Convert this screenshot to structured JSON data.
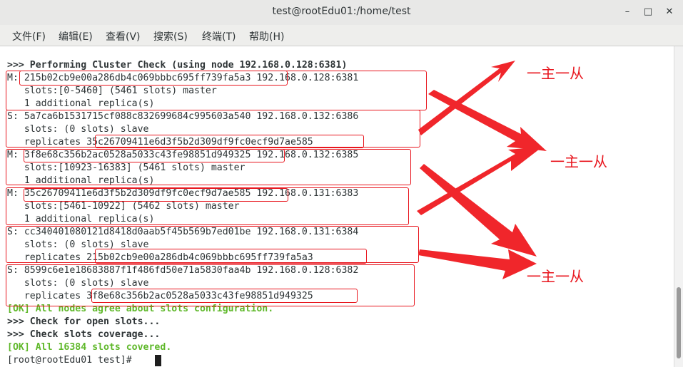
{
  "window": {
    "title": "test@rootEdu01:/home/test"
  },
  "menu": [
    "文件(F)",
    "编辑(E)",
    "查看(V)",
    "搜索(S)",
    "终端(T)",
    "帮助(H)"
  ],
  "terminal_lines": [
    {
      "prefix": ">>> ",
      "text": "Performing Cluster Check (using node 192.168.0.128:6381)",
      "style": "bold"
    },
    {
      "prefix": "M: ",
      "text": "215b02cb9e00a286db4c069bbbc695ff739fa5a3 192.168.0.128:6381",
      "style": ""
    },
    {
      "prefix": "   ",
      "text": "slots:[0-5460] (5461 slots) master",
      "style": ""
    },
    {
      "prefix": "   ",
      "text": "1 additional replica(s)",
      "style": ""
    },
    {
      "prefix": "S: ",
      "text": "5a7ca6b1531715cf088c832699684c995603a540 192.168.0.132:6386",
      "style": ""
    },
    {
      "prefix": "   ",
      "text": "slots: (0 slots) slave",
      "style": ""
    },
    {
      "prefix": "   ",
      "text": "replicates 35c26709411e6d3f5b2d309df9fc0ecf9d7ae585",
      "style": ""
    },
    {
      "prefix": "M: ",
      "text": "3f8e68c356b2ac0528a5033c43fe98851d949325 192.168.0.132:6385",
      "style": ""
    },
    {
      "prefix": "   ",
      "text": "slots:[10923-16383] (5461 slots) master",
      "style": ""
    },
    {
      "prefix": "   ",
      "text": "1 additional replica(s)",
      "style": ""
    },
    {
      "prefix": "M: ",
      "text": "35c26709411e6d3f5b2d309df9fc0ecf9d7ae585 192.168.0.131:6383",
      "style": ""
    },
    {
      "prefix": "   ",
      "text": "slots:[5461-10922] (5462 slots) master",
      "style": ""
    },
    {
      "prefix": "   ",
      "text": "1 additional replica(s)",
      "style": ""
    },
    {
      "prefix": "S: ",
      "text": "cc340401080121d8418d0aab5f45b569b7ed01be 192.168.0.131:6384",
      "style": ""
    },
    {
      "prefix": "   ",
      "text": "slots: (0 slots) slave",
      "style": ""
    },
    {
      "prefix": "   ",
      "text": "replicates 215b02cb9e00a286db4c069bbbc695ff739fa5a3",
      "style": ""
    },
    {
      "prefix": "S: ",
      "text": "8599c6e1e18683887f1f486fd50e71a5830faa4b 192.168.0.128:6382",
      "style": ""
    },
    {
      "prefix": "   ",
      "text": "slots: (0 slots) slave",
      "style": ""
    },
    {
      "prefix": "   ",
      "text": "replicates 3f8e68c356b2ac0528a5033c43fe98851d949325",
      "style": ""
    },
    {
      "prefix": "[OK] ",
      "text": "All nodes agree about slots configuration.",
      "style": "green"
    },
    {
      "prefix": ">>> ",
      "text": "Check for open slots...",
      "style": "bold"
    },
    {
      "prefix": ">>> ",
      "text": "Check slots coverage...",
      "style": "bold"
    },
    {
      "prefix": "[OK] ",
      "text": "All 16384 slots covered.",
      "style": "green"
    },
    {
      "prefix": "",
      "text": "[root@rootEdu01 test]# ",
      "style": ""
    }
  ],
  "annotations": {
    "note1": "一主一从",
    "note2": "一主一从",
    "note3": "一主一从"
  },
  "colors": {
    "annotation": "#e8161e",
    "ok": "#5fb82a"
  }
}
